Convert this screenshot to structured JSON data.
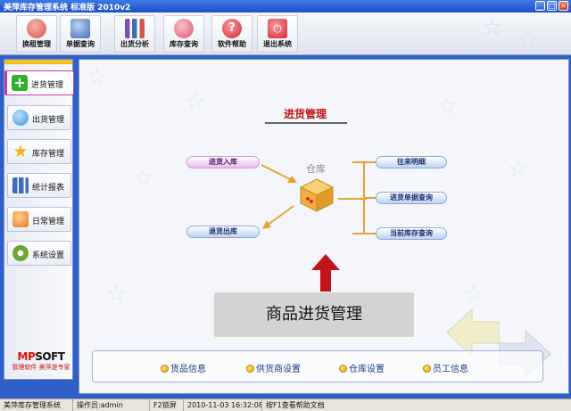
{
  "window": {
    "title": "美萍库存管理系统 标准版 2010v2"
  },
  "toolbar": {
    "buttons": [
      {
        "label": "换租管理",
        "icon": "users-icon",
        "color": "#d9534f"
      },
      {
        "label": "单据查询",
        "icon": "document-search-icon",
        "color": "#3f6fb5"
      },
      {
        "label": "出货分析",
        "icon": "bar-chart-icon",
        "color": "#7a52b3"
      },
      {
        "label": "库存查询",
        "icon": "stock-icon",
        "color": "#e0556b"
      },
      {
        "label": "软件帮助",
        "icon": "help-icon",
        "color": "#d9242e"
      },
      {
        "label": "退出系统",
        "icon": "exit-icon",
        "color": "#d9242e"
      }
    ]
  },
  "sidebar": {
    "items": [
      {
        "label": "进货管理",
        "icon": "plus-icon",
        "color": "#2fae2f",
        "active": true
      },
      {
        "label": "出货管理",
        "icon": "shipping-icon",
        "color": "#3a8fd6",
        "active": false
      },
      {
        "label": "库存管理",
        "icon": "star-icon",
        "color": "#f2b21a",
        "active": false
      },
      {
        "label": "统计报表",
        "icon": "report-icon",
        "color": "#3d6cc2",
        "active": false
      },
      {
        "label": "日常管理",
        "icon": "daily-icon",
        "color": "#e27a2a",
        "active": false
      },
      {
        "label": "系统设置",
        "icon": "settings-icon",
        "color": "#6ba63a",
        "active": false
      }
    ],
    "logo": {
      "brand_prefix": "MP",
      "brand_suffix": "SOFT",
      "tagline": "管理软件 美萍是专家"
    }
  },
  "main": {
    "heading": "进货管理",
    "diagram": {
      "box_label": "仓库",
      "left_actions": [
        "进货入库",
        "退货出库"
      ],
      "right_actions": [
        "往来明细",
        "进货单据查询",
        "当前库存查询"
      ]
    },
    "banner": "商品进货管理",
    "bottom_links": [
      "货品信息",
      "供货商设置",
      "仓库设置",
      "员工信息"
    ]
  },
  "statusbar": {
    "app_name": "美萍库存管理系统",
    "operator": "操作员:admin",
    "lock_hint": "F2锁屏",
    "datetime": "2010-11-03 16:32:08",
    "help_hint": "按F1查看帮助文档"
  },
  "colors": {
    "accent_red": "#c01010",
    "frame_blue": "#2f60c8",
    "connector_orange": "#e5a233"
  }
}
